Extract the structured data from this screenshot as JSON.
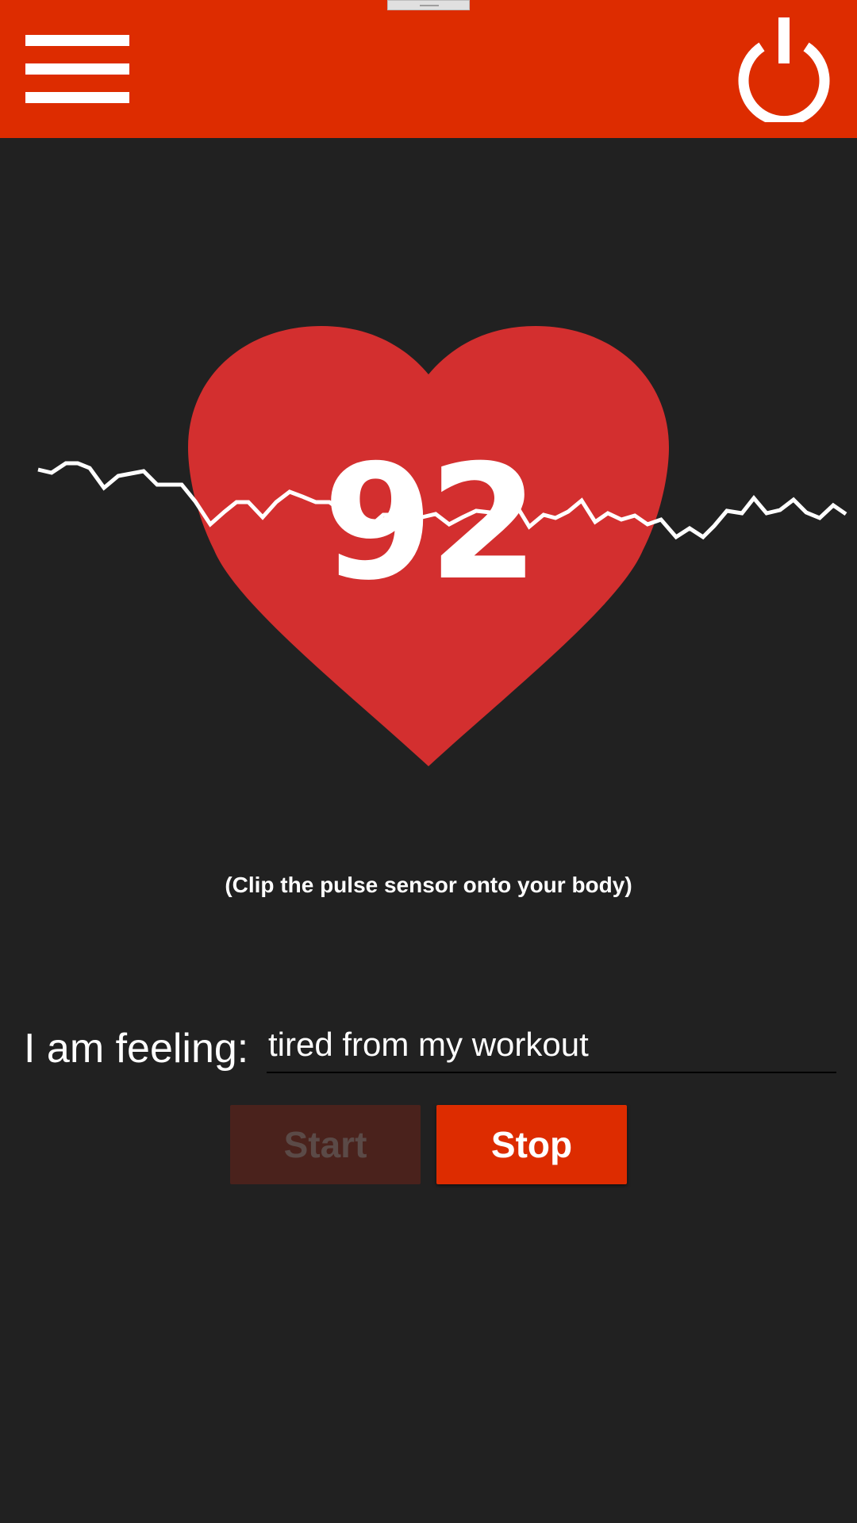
{
  "app": {
    "colors": {
      "appbar": "#dd2c00",
      "background": "#212121",
      "heart": "#d32f2f",
      "stop_button": "#dd2c00",
      "start_button_disabled": "#4a221c"
    }
  },
  "appbar": {
    "menu_icon": "hamburger-menu-icon",
    "power_icon": "power-icon"
  },
  "monitor": {
    "bpm": "92",
    "hint": "(Clip the pulse sensor onto your body)"
  },
  "feeling": {
    "label": "I am feeling:",
    "value": "tired from my workout"
  },
  "controls": {
    "start_label": "Start",
    "stop_label": "Stop",
    "start_enabled": false,
    "stop_enabled": true
  }
}
